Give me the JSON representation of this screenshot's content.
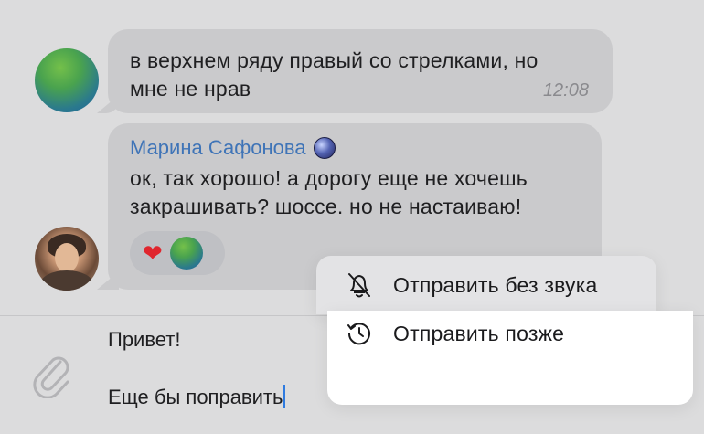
{
  "messages": [
    {
      "text": "в верхнем ряду правый со стрелками, но\nмне не нрав",
      "time": "12:08"
    },
    {
      "sender": "Марина Сафонова",
      "text": "ок, так хорошо! а дорогу еще не хочешь\nзакрашивать? шоссе. но не настаиваю!",
      "reactions": [
        "heart",
        "avatar"
      ]
    }
  ],
  "composer": {
    "line1": "Привет!",
    "line2": "Еще бы поправить"
  },
  "context_menu": {
    "silent_label": "Отправить без звука",
    "later_label": "Отправить позже"
  },
  "colors": {
    "background": "#dcdcdd",
    "bubble": "#cacacc",
    "sender": "#3f74b7",
    "send": "#2f7be0",
    "heart": "#e0262e"
  },
  "icons": [
    "paperclip-icon",
    "emoji-icon",
    "send-icon",
    "bell-off-icon",
    "clock-icon",
    "heart-icon"
  ]
}
